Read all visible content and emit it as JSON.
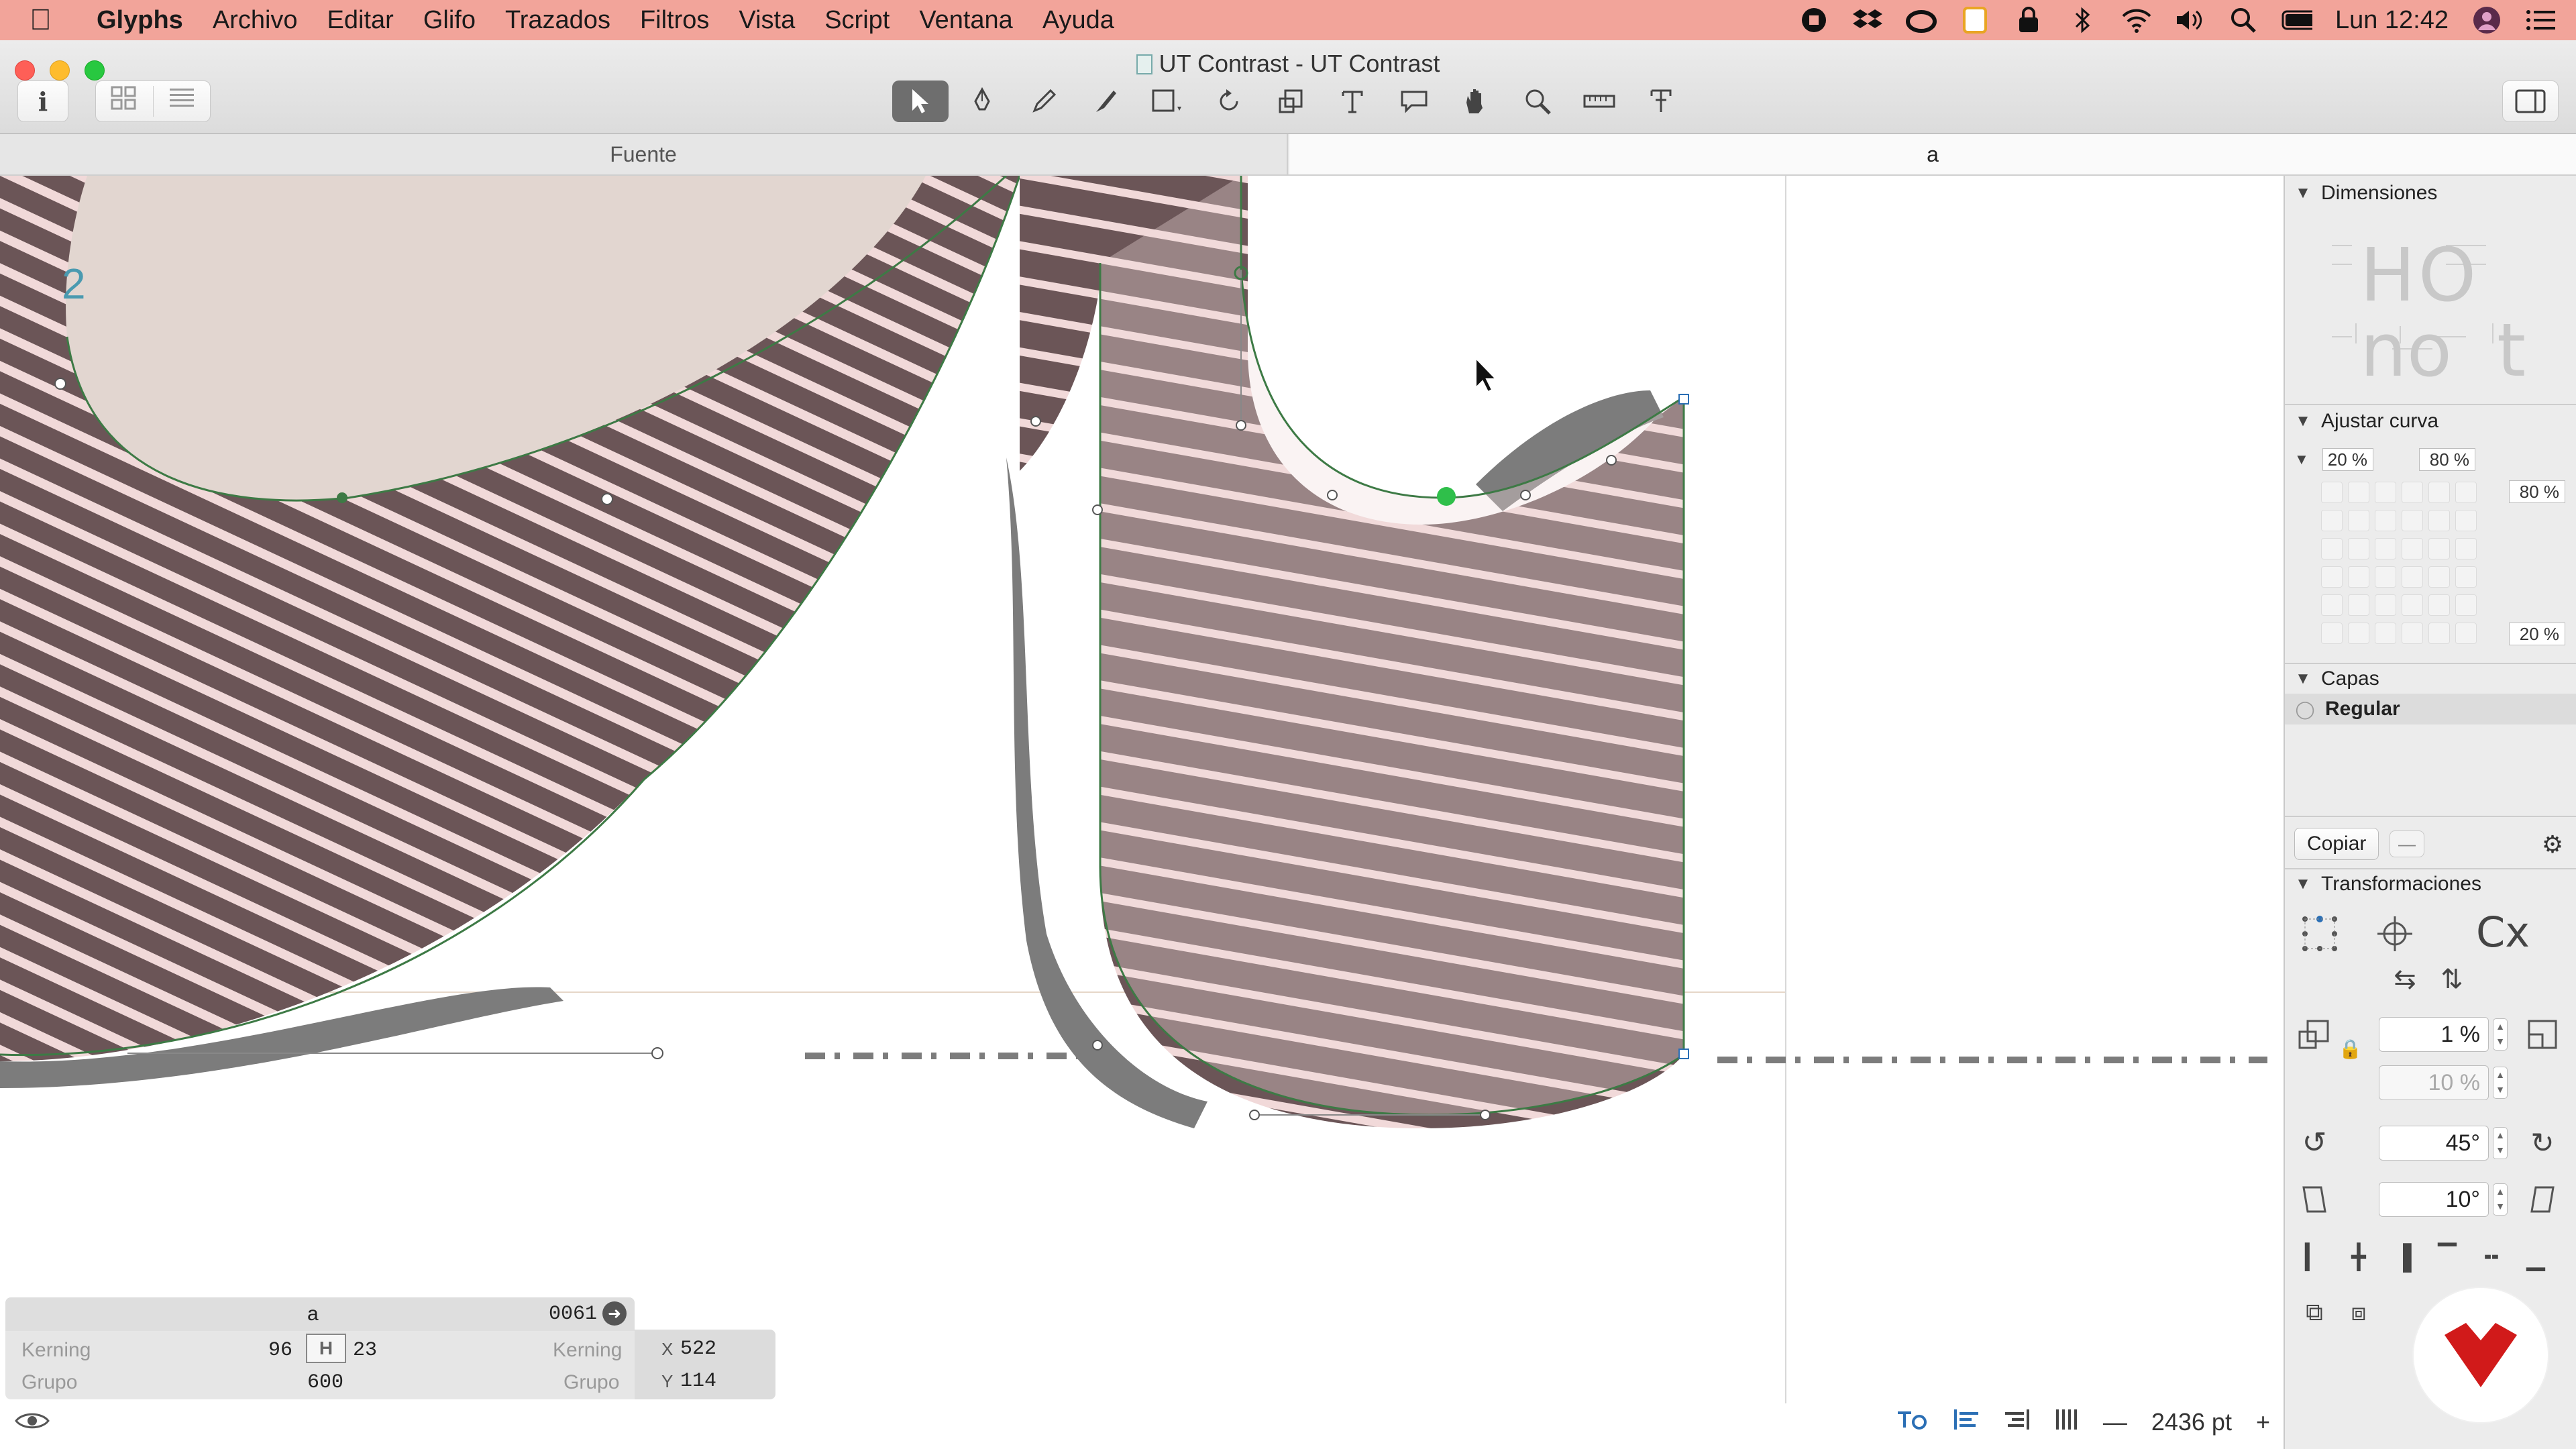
{
  "menubar": {
    "app": "Glyphs",
    "items": [
      "Archivo",
      "Editar",
      "Glifo",
      "Trazados",
      "Filtros",
      "Vista",
      "Script",
      "Ventana",
      "Ayuda"
    ],
    "clock": "Lun 12:42",
    "status_icons": [
      "record-icon",
      "dropbox-icon",
      "creative-cloud-icon",
      "notes-icon",
      "vpn-icon",
      "bluetooth-icon",
      "wifi-icon",
      "volume-icon",
      "spotlight-icon",
      "battery-icon",
      "user-avatar-icon",
      "notification-center-icon"
    ]
  },
  "window": {
    "title": "UT Contrast - UT Contrast",
    "info_label": "i",
    "tools": [
      "select-tool",
      "draw-pen-tool",
      "pencil-tool",
      "brush-tool",
      "primitives-tool",
      "rotate-tool",
      "scale-tool",
      "text-tool",
      "annotation-tool",
      "hand-tool",
      "zoom-tool",
      "measure-tool",
      "knife-tool"
    ],
    "active_tool": "select-tool"
  },
  "tabs": {
    "font_tab": "Fuente",
    "glyph_tab": "a"
  },
  "canvas": {
    "layer_number": "2"
  },
  "infobox": {
    "glyph_name": "a",
    "unicode": "0061",
    "kerning_label_left": "Kerning",
    "kerning_label_right": "Kerning",
    "group_label_left": "Grupo",
    "group_label_right": "Grupo",
    "lsb": "96",
    "rsb": "23",
    "width": "600",
    "x_label": "X",
    "x_value": "522",
    "y_label": "Y",
    "y_value": "114"
  },
  "statusbar": {
    "zoom": "2436 pt",
    "minus": "—",
    "plus": "+"
  },
  "panel": {
    "dimensions_title": "Dimensiones",
    "preview_HO": "HO",
    "preview_no": "no",
    "preview_t": "t",
    "fit_curve_title": "Ajustar curva",
    "fit_curve_min": "20 %",
    "fit_curve_max": "80 %",
    "fit_curve_right_top": "80 %",
    "fit_curve_right_bottom": "20 %",
    "layers_title": "Capas",
    "layer_name": "Regular",
    "copy_label": "Copiar",
    "minus_label": "—",
    "transform_title": "Transformaciones",
    "transform_cx": "Cx",
    "scale_value": "1 %",
    "scale_value_2": "10 %",
    "rotate_value": "45°",
    "slant_value": "10°"
  },
  "colors": {
    "menubar_bg": "#f2a49a",
    "glyph_fill": "#f4e2e2",
    "ink": "#6b5557",
    "outline": "#3d7a45",
    "logo_red": "#d11a1a"
  }
}
